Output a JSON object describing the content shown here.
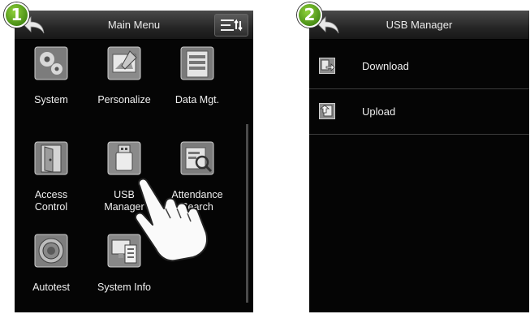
{
  "steps": [
    "1",
    "2"
  ],
  "main_menu": {
    "title": "Main Menu",
    "items": [
      {
        "label": "System",
        "icon": "gear-icon"
      },
      {
        "label": "Personalize",
        "icon": "personalize-icon"
      },
      {
        "label": "Data Mgt.",
        "icon": "data-management-icon"
      },
      {
        "label": "Access\nControl",
        "icon": "door-icon"
      },
      {
        "label": "USB\nManager",
        "icon": "usb-drive-icon"
      },
      {
        "label": "Attendance\nSearch",
        "icon": "attendance-search-icon"
      },
      {
        "label": "Autotest",
        "icon": "autotest-icon"
      },
      {
        "label": "System Info",
        "icon": "system-info-icon"
      }
    ]
  },
  "usb_manager": {
    "title": "USB Manager",
    "items": [
      {
        "label": "Download",
        "icon": "download-icon"
      },
      {
        "label": "Upload",
        "icon": "upload-icon"
      }
    ]
  },
  "colors": {
    "badge": "#5aa81f",
    "screen": "#050505",
    "topbar": "#2a2a2a"
  }
}
